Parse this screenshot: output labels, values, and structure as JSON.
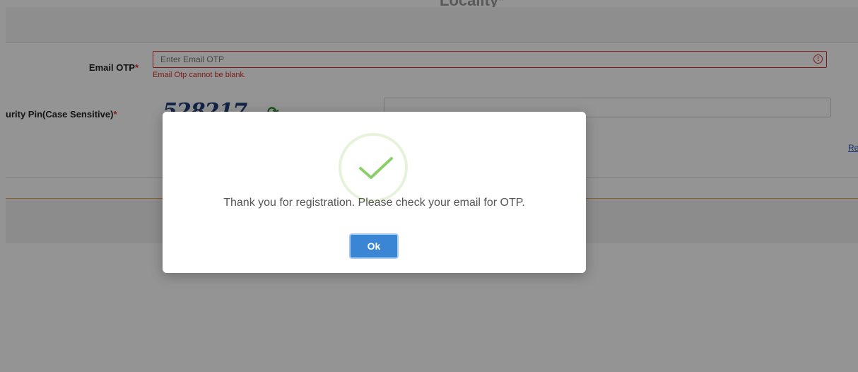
{
  "background": {
    "top_label": "Locality*",
    "email_otp": {
      "label": "Email OTP",
      "required_mark": "*",
      "placeholder": "Enter Email OTP",
      "error": "Email Otp cannot be blank."
    },
    "security_pin": {
      "label": "urity Pin(Case Sensitive)",
      "required_mark": "*",
      "captcha_text": "528217"
    },
    "right_link": "Re"
  },
  "modal": {
    "message": "Thank you for registration. Please check your email for OTP.",
    "ok_label": "Ok",
    "icon": "check-icon",
    "accent": "#3a86d4",
    "success_color": "#8ccf6a"
  }
}
